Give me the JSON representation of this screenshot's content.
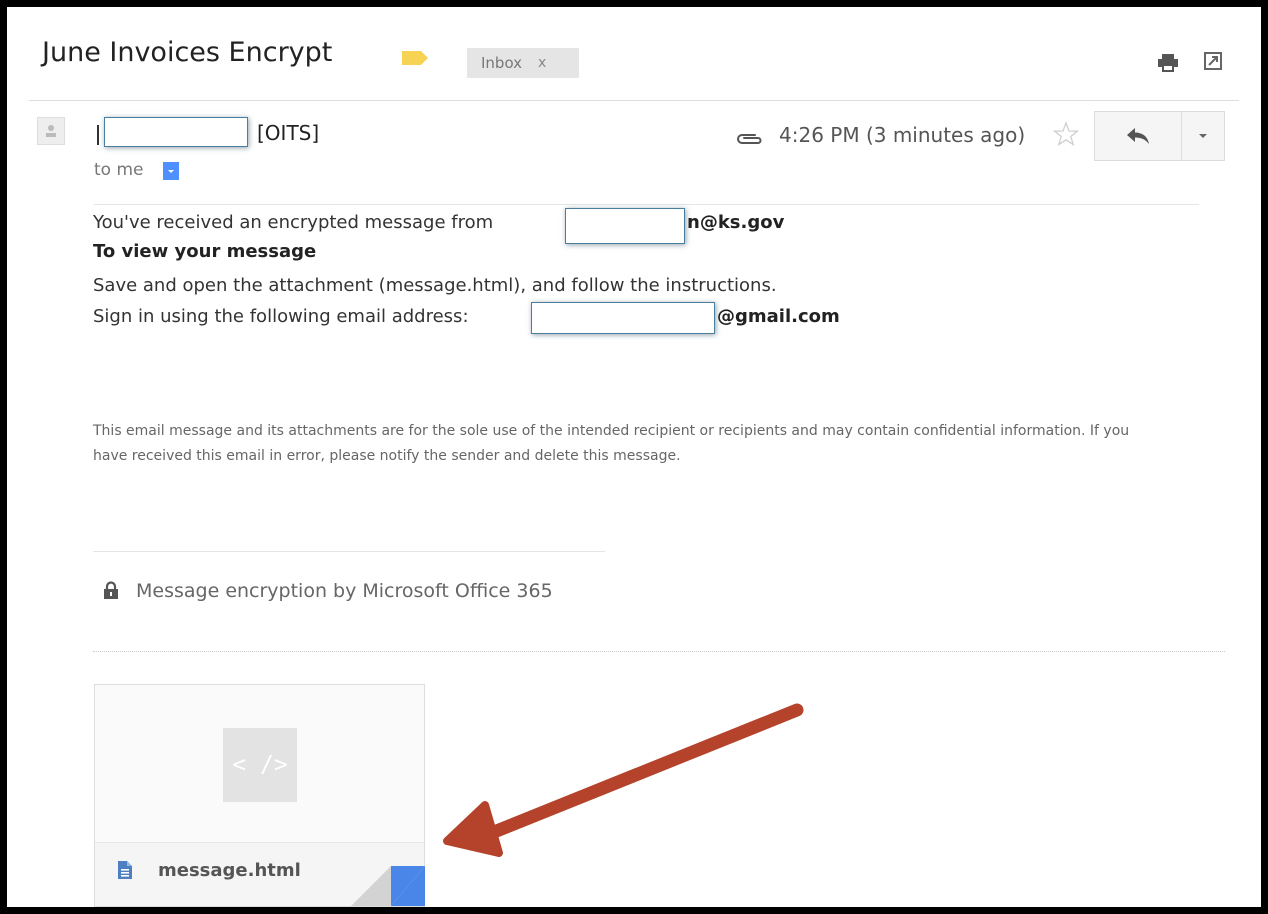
{
  "email": {
    "subject": "June Invoices Encrypt",
    "inbox_label": "Inbox",
    "inbox_remove": "x",
    "sender_org": "[OITS]",
    "to": "to me",
    "time": "4:26 PM (3 minutes ago)"
  },
  "body": {
    "line1": "You've received an encrypted message from",
    "from_domain": "n@ks.gov",
    "heading": "To view your message",
    "instructions": "Save and open the attachment (message.html), and follow the instructions.",
    "signin": "Sign in using the following email address:",
    "email_domain": "@gmail.com",
    "disclaimer": "This email message and its attachments are for the sole use of the intended recipient or recipients and may contain confidential information. If you have received this email in error, please notify the sender and delete this message.",
    "encryption": "Message encryption by Microsoft Office 365"
  },
  "attachment": {
    "preview_symbol": "< />",
    "filename": "message.html"
  },
  "colors": {
    "label_tag": "#f7d354",
    "accent_blue": "#4d90fe",
    "arrow": "#b5422b"
  },
  "icons": [
    "label-tag-icon",
    "print-icon",
    "popout-icon",
    "avatar-icon",
    "dropdown-icon",
    "paperclip-icon",
    "star-icon",
    "reply-icon",
    "chevron-down-icon",
    "lock-icon",
    "code-icon",
    "document-icon",
    "fold-icon"
  ]
}
